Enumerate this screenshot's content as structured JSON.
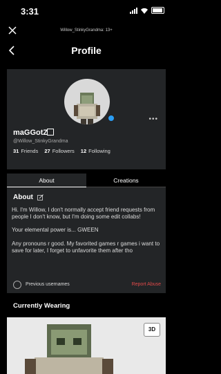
{
  "status_bar": {
    "time": "3:31"
  },
  "topbar": {
    "site_title": "Willow_StinkyGrandma: 13+"
  },
  "header": {
    "title": "Profile"
  },
  "profile": {
    "display_name": "maGGotZ",
    "handle": "@Willow_StinkyGrandma",
    "friends_count": "31",
    "friends_label": "Friends",
    "followers_count": "27",
    "followers_label": "Followers",
    "following_count": "12",
    "following_label": "Following"
  },
  "tabs": [
    {
      "label": "About"
    },
    {
      "label": "Creations"
    }
  ],
  "about": {
    "heading": "About",
    "paragraphs": [
      "Hi. I'm Willow, I don't normally accept friend requests from people I don't know, but I'm doing some edit collabs!",
      "Your elemental power is... GWEEN",
      "Any pronouns r good.                    My favorited games r games i want to save for later, I forget to unfavorite them after tho"
    ]
  },
  "footer": {
    "previous_usernames": "Previous usernames",
    "report_abuse": "Report Abuse"
  },
  "wearing": {
    "heading": "Currently Wearing",
    "view_3d_label": "3D"
  },
  "colors": {
    "accent_blue": "#2a9df4",
    "report_red": "#e24a4a",
    "panel": "#232527"
  }
}
